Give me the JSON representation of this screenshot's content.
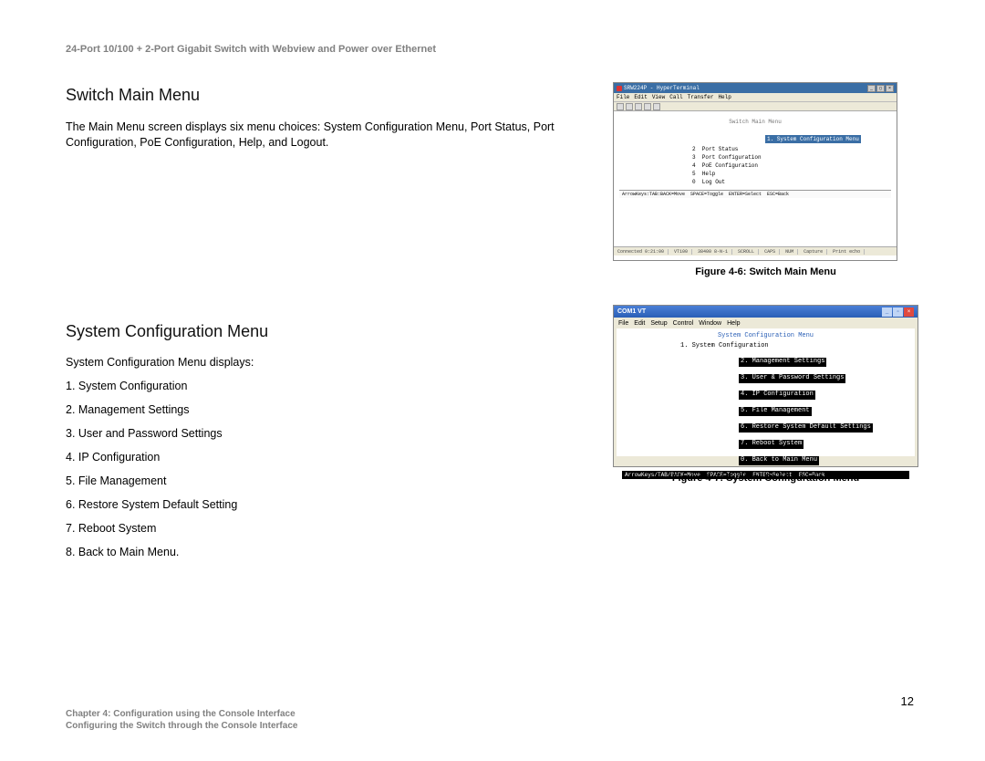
{
  "header": {
    "title": "24-Port 10/100 + 2-Port Gigabit Switch with Webview and Power over Ethernet"
  },
  "section1": {
    "heading": "Switch Main Menu",
    "body": "The Main Menu screen displays six menu choices: System Configuration Menu, Port Status, Port Configuration, PoE Configuration, Help, and Logout."
  },
  "section2": {
    "heading": "System Configuration Menu",
    "intro": "System Configuration Menu displays:",
    "items": [
      "1. System Configuration",
      "2. Management Settings",
      "3. User and Password Settings",
      "4. IP Configuration",
      "5. File Management",
      "6. Restore System Default Setting",
      "7. Reboot System",
      "8. Back to Main Menu."
    ]
  },
  "figure1": {
    "caption": "Figure 4-6: Switch Main Menu",
    "window_title": "SRW224P - HyperTerminal",
    "menubar": [
      "File",
      "Edit",
      "View",
      "Call",
      "Transfer",
      "Help"
    ],
    "inner_title": "Switch Main Menu",
    "menu": [
      "1. System Configuration Menu",
      "2  Port Status",
      "3  Port Configuration",
      "4  PoE Configuration",
      "5  Help",
      "0  Log Out"
    ],
    "helpbar": "ArrowKeys:TAB:BACK=Move  SPACE=Toggle  ENTER=Select  ESC=Back",
    "statusbar": [
      "Connected 0:21:00",
      "VT100",
      "38400 8-N-1",
      "SCROLL",
      "CAPS",
      "NUM",
      "Capture",
      "Print echo"
    ]
  },
  "figure2": {
    "caption": "Figure 4-7: System Configuration Menu",
    "window_title": "COM1 VT",
    "menubar": [
      "File",
      "Edit",
      "Setup",
      "Control",
      "Window",
      "Help"
    ],
    "inner_title": "System Configuration Menu",
    "menu": [
      "1. System Configuration",
      "2. Management Settings",
      "3. User & Password Settings",
      "4. IP Configuration",
      "5. File Management",
      "6. Restore System Default Settings",
      "7. Reboot System",
      "0. Back to Main Menu"
    ],
    "helpbar": "ArrowKeys/TAB/BACK=Move  SPACE=Toggle  ENTER=Select  ESC=Back"
  },
  "page_number": "12",
  "footer": {
    "line1": "Chapter 4: Configuration using the Console Interface",
    "line2": "Configuring the Switch through the Console Interface"
  }
}
